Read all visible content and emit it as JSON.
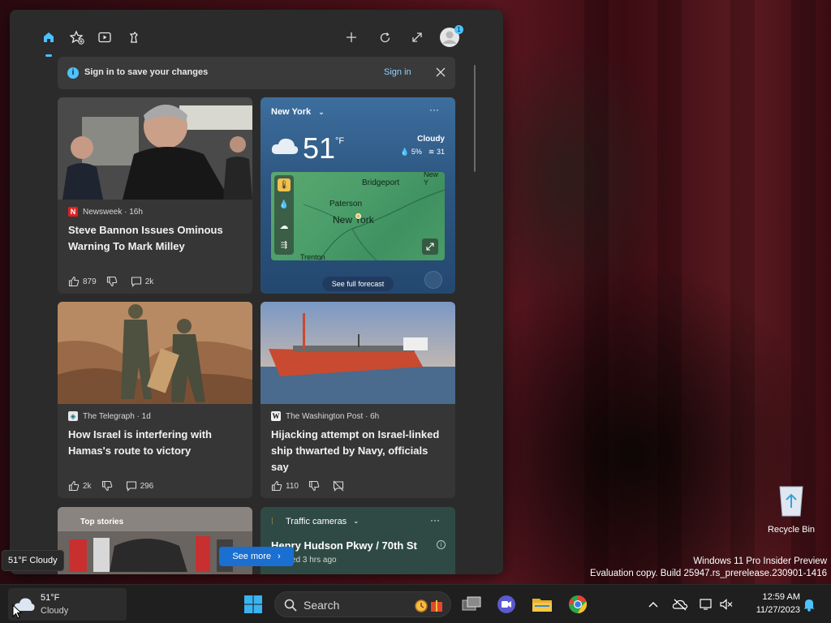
{
  "signin": {
    "message": "Sign in to save your changes",
    "link": "Sign in"
  },
  "profile_badge": "1",
  "cards": [
    {
      "source": "Newsweek",
      "age": "16h",
      "headline": "Steve Bannon Issues Ominous Warning To Mark Milley",
      "likes": "879",
      "comments": "2k"
    },
    {
      "source": "The Telegraph",
      "age": "1d",
      "headline": "How Israel is interfering with Hamas's route to victory",
      "likes": "2k",
      "comments": "296"
    },
    {
      "source": "The Washington Post",
      "age": "6h",
      "headline": "Hijacking attempt on Israel-linked ship thwarted by Navy, officials say",
      "likes": "110"
    }
  ],
  "weather": {
    "location": "New York",
    "temp": "51",
    "unit": "°F",
    "condition": "Cloudy",
    "precip": "5%",
    "aqi": "31",
    "map_labels": [
      "Bridgeport",
      "Paterson",
      "New York",
      "Trenton",
      "New Y"
    ],
    "forecast_button": "See full forecast"
  },
  "top_stories": "Top stories",
  "see_more": "See more",
  "traffic": {
    "title": "Traffic cameras",
    "road": "Henry Hudson Pkwy / 70th St",
    "updated": "ed 3 hrs ago"
  },
  "tooltip": "51°F Cloudy",
  "watermark": {
    "line1": "Windows 11 Pro Insider Preview",
    "line2": "Evaluation copy. Build 25947.rs_prerelease.230901-1416"
  },
  "recycle_bin": "Recycle Bin",
  "taskbar": {
    "weather_temp": "51°F",
    "weather_cond": "Cloudy",
    "search_placeholder": "Search",
    "time": "12:59 AM",
    "date": "11/27/2023"
  },
  "colors": {
    "accent": "#4cc2ff",
    "panel": "#2b2b2b",
    "card": "#363636",
    "see_more": "#1a6fd0"
  }
}
